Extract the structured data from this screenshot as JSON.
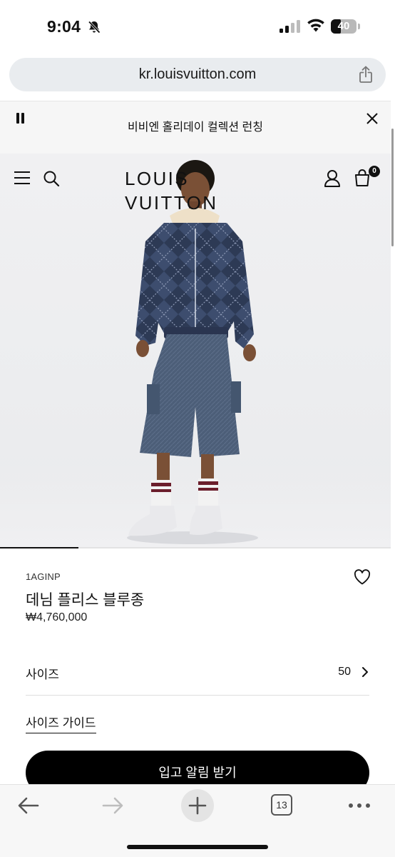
{
  "status_bar": {
    "time": "9:04",
    "battery": "40",
    "battery_level": 0.4,
    "icons": [
      "bell-slash-icon",
      "cellular-signal-icon",
      "wifi-icon",
      "battery-icon"
    ]
  },
  "browser": {
    "url": "kr.louisvuitton.com",
    "share_icon": "share-icon",
    "tab_count": "13",
    "toolbar_icons": [
      "back-arrow-icon",
      "forward-arrow-icon",
      "plus-icon",
      "tabs-icon",
      "more-icon"
    ]
  },
  "banner": {
    "text": "비비엔 홀리데이 컬렉션 런칭",
    "icons": [
      "pause-icon",
      "close-icon"
    ]
  },
  "header": {
    "logo": "LOUIS VUITTON",
    "bag_count": "0",
    "icons": [
      "menu-icon",
      "search-icon",
      "user-icon",
      "shopping-bag-icon"
    ]
  },
  "gallery": {
    "progress": 0.2
  },
  "product": {
    "sku": "1AGINP",
    "name": "데님 플리스 블루종",
    "price": "₩4,760,000",
    "size_label": "사이즈",
    "size_value": "50",
    "size_guide": "사이즈 가이드",
    "cta": "입고 알림 받기"
  },
  "colors": {
    "accent": "#000000",
    "background": "#ffffff",
    "hero_bg": "#eeeff1"
  }
}
